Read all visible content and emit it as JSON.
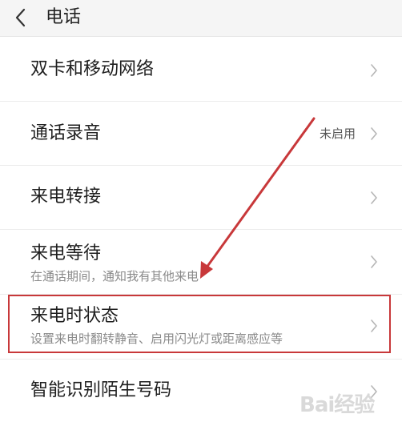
{
  "header": {
    "title": "电话",
    "back_icon": "chevron-left-icon"
  },
  "rows": [
    {
      "title": "双卡和移动网络",
      "subtitle": "",
      "status": ""
    },
    {
      "title": "通话录音",
      "subtitle": "",
      "status": "未启用"
    },
    {
      "title": "来电转接",
      "subtitle": "",
      "status": ""
    },
    {
      "title": "来电等待",
      "subtitle": "在通话期间，通知我有其他来电",
      "status": ""
    },
    {
      "title": "来电时状态",
      "subtitle": "设置来电时翻转静音、启用闪光灯或距离感应等",
      "status": ""
    },
    {
      "title": "智能识别陌生号码",
      "subtitle": "",
      "status": ""
    }
  ],
  "annotation": {
    "highlight_color": "#c8383a",
    "arrow_color": "#c8383a",
    "highlighted_row": 4
  },
  "watermark": {
    "text": "Bai经验"
  }
}
